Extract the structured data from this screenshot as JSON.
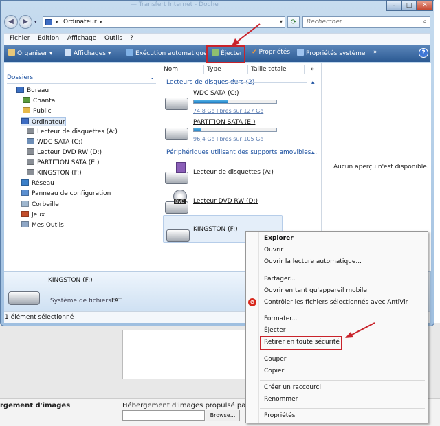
{
  "window": {
    "title_ghost": "— Transfert Internet - Doche",
    "controls": {
      "minimize": "–",
      "maximize": "□",
      "close": "✕"
    }
  },
  "address": {
    "path": "Ordinateur",
    "sep": "▸",
    "search_placeholder": "Rechercher"
  },
  "menubar": {
    "items": [
      "Fichier",
      "Edition",
      "Affichage",
      "Outils",
      "?"
    ]
  },
  "toolbar": {
    "organiser": "Organiser ▾",
    "affichages": "Affichages ▾",
    "execution": "Exécution automatique",
    "ejecter": "Éjecter",
    "proprietes": "Propriétés",
    "proprietes_systeme": "Propriétés système",
    "more": "»",
    "help": "?"
  },
  "tree": {
    "header": "Dossiers",
    "items": [
      {
        "label": "Bureau",
        "icon": "desktop-icon",
        "color": "#3b6fc2"
      },
      {
        "label": "Chantal",
        "icon": "user-folder-icon",
        "color": "#5a9a3c"
      },
      {
        "label": "Public",
        "icon": "folder-icon",
        "color": "#e6b94a"
      },
      {
        "label": "Ordinateur",
        "icon": "computer-icon",
        "color": "#3d6cc3"
      },
      {
        "label": "Lecteur de disquettes (A:)",
        "icon": "floppy-icon",
        "color": "#8a8f96"
      },
      {
        "label": "WDC SATA (C:)",
        "icon": "drive-windows-icon",
        "color": "#6e8fb8"
      },
      {
        "label": "Lecteur DVD RW (D:)",
        "icon": "dvd-drive-icon",
        "color": "#8a8f96"
      },
      {
        "label": "PARTITION SATA (E:)",
        "icon": "drive-icon",
        "color": "#8a8f96"
      },
      {
        "label": "KINGSTON (F:)",
        "icon": "usb-drive-icon",
        "color": "#8a8f96"
      },
      {
        "label": "Réseau",
        "icon": "network-icon",
        "color": "#3b7fc8"
      },
      {
        "label": "Panneau de configuration",
        "icon": "control-panel-icon",
        "color": "#5b8fd0"
      },
      {
        "label": "Corbeille",
        "icon": "recycle-bin-icon",
        "color": "#9fb7cf"
      },
      {
        "label": "Jeux",
        "icon": "games-icon",
        "color": "#c44f2c"
      },
      {
        "label": "Mes Outils",
        "icon": "tools-folder-icon",
        "color": "#8fa7c6"
      }
    ]
  },
  "columns": {
    "nom": "Nom",
    "type": "Type",
    "taille": "Taille totale",
    "more": "»"
  },
  "groups": {
    "hdd": "Lecteurs de disques durs (2)",
    "removable": "Périphériques utilisant des supports amovibles ..."
  },
  "drives": {
    "c": {
      "name": "WDC SATA (C:)",
      "free": "74,8 Go libres sur 127 Go",
      "used_fraction": 0.41
    },
    "e": {
      "name": "PARTITION SATA (E:)",
      "free": "96,4 Go libres sur 105 Go",
      "used_fraction": 0.08
    },
    "a": {
      "name": "Lecteur de disquettes (A:)"
    },
    "d": {
      "name": "Lecteur DVD RW (D:)",
      "dvd_label": "DVD"
    },
    "f": {
      "name": "KINGSTON (F:)"
    }
  },
  "preview": {
    "text": "Aucun aperçu n'est disponible."
  },
  "details": {
    "title": "KINGSTON (F:)",
    "fs_label": "Système de fichiers :",
    "fs_value": "FAT"
  },
  "status": {
    "text": "1 élément sélectionné"
  },
  "context_menu": {
    "items": {
      "explorer": "Explorer",
      "ouvrir": "Ouvrir",
      "lecture_auto": "Ouvrir la lecture automatique...",
      "partager": "Partager...",
      "mobile": "Ouvrir en tant qu'appareil mobile",
      "antivir": "Contrôler les fichiers sélectionnés avec AntiVir",
      "formater": "Formater...",
      "ejecter": "Éjecter",
      "retirer": "Retirer en toute sécurité",
      "couper": "Couper",
      "copier": "Copier",
      "raccourci": "Créer un raccourci",
      "renommer": "Renommer",
      "proprietes": "Propriétés"
    }
  },
  "background_page": {
    "left_title": "rgement d'images",
    "mid_title": "Hébergement d'images propulsé pa",
    "browse": "Browse..."
  },
  "colors": {
    "annotation_red": "#c9232b",
    "toolbar_blue": "#2c5a93"
  }
}
